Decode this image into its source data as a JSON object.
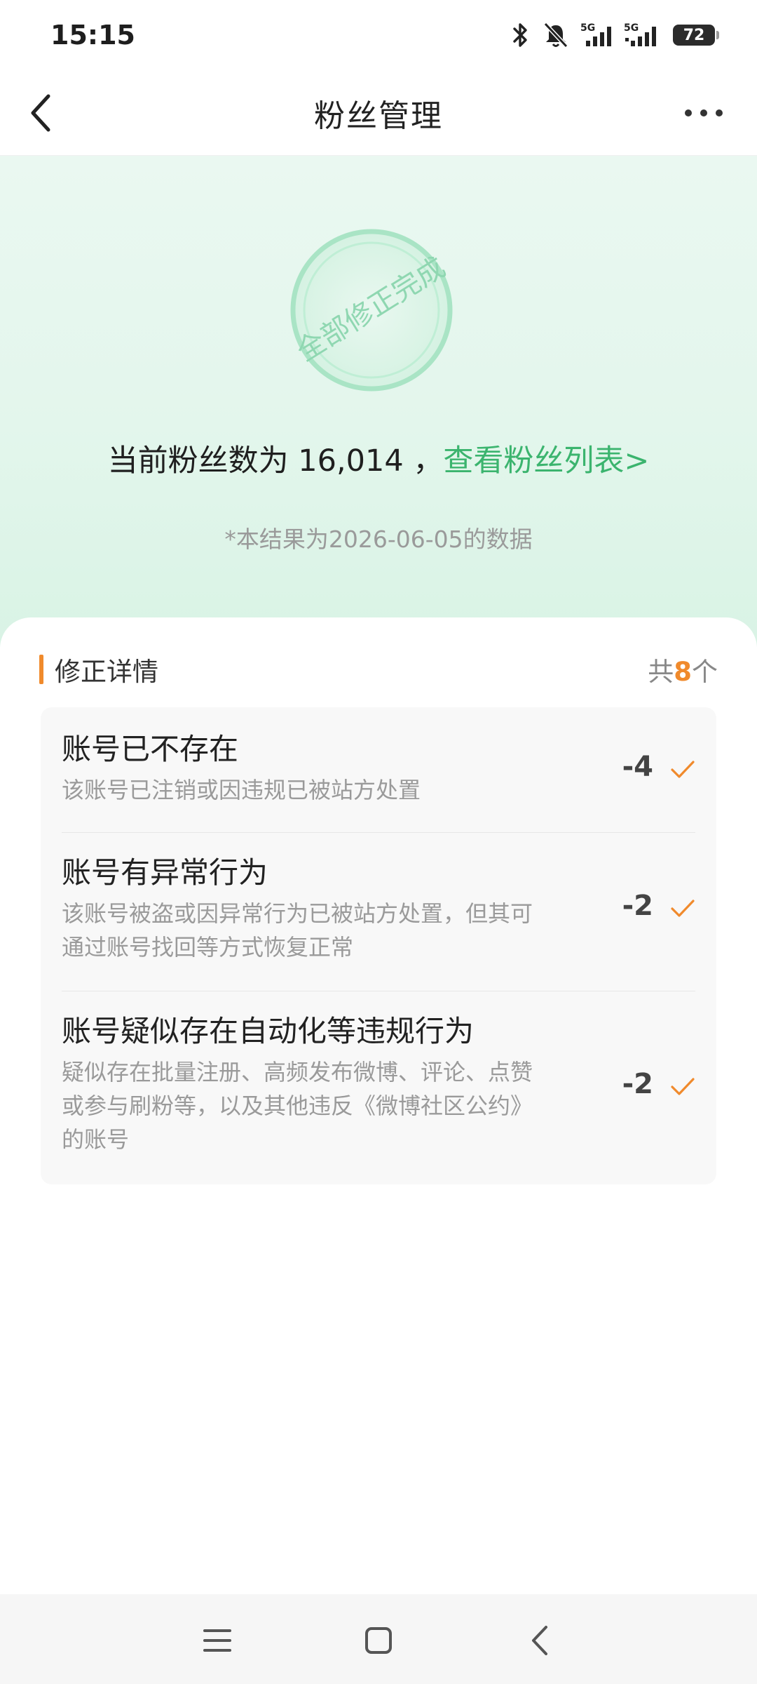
{
  "status_bar": {
    "time": "15:15",
    "network_1": "5G",
    "network_2": "5G",
    "battery": "72"
  },
  "header": {
    "title": "粉丝管理"
  },
  "hero": {
    "stamp_text": "全部修正完成",
    "fans_prefix": "当前粉丝数为 16,014 ，",
    "fans_link": "查看粉丝列表>",
    "date_note": "*本结果为2026-06-05的数据",
    "accent_color": "#3bb46e"
  },
  "details": {
    "title": "修正详情",
    "count_prefix": "共",
    "count_value": "8",
    "count_suffix": "个",
    "items": [
      {
        "title": "账号已不存在",
        "desc": "该账号已注销或因违规已被站方处置",
        "value": "-4"
      },
      {
        "title": "账号有异常行为",
        "desc": "该账号被盗或因异常行为已被站方处置，但其可通过账号找回等方式恢复正常",
        "value": "-2"
      },
      {
        "title": "账号疑似存在自动化等违规行为",
        "desc": "疑似存在批量注册、高频发布微博、评论、点赞或参与刷粉等，以及其他违反《微博社区公约》的账号",
        "value": "-2"
      }
    ],
    "check_color": "#f08a2c"
  },
  "nav": {
    "icons": [
      "menu-icon",
      "home-square-icon",
      "back-chevron-icon"
    ]
  }
}
